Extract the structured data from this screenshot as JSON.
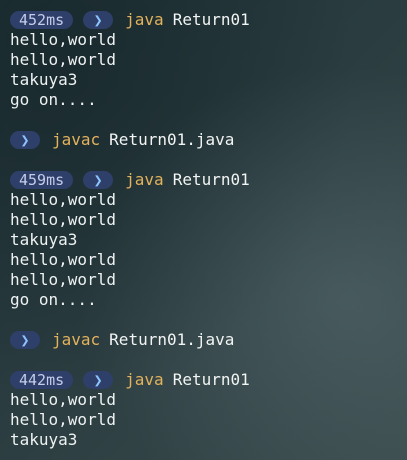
{
  "blocks": [
    {
      "time": "452ms",
      "prompt_icon": "chevron-right-icon",
      "command": "java",
      "argument": "Return01",
      "output": [
        "hello,world",
        "hello,world",
        "takuya3",
        "go on...."
      ]
    },
    {
      "prompt_icon": "chevron-right-icon",
      "command": "javac",
      "argument": "Return01.java"
    },
    {
      "time": "459ms",
      "prompt_icon": "chevron-right-icon",
      "command": "java",
      "argument": "Return01",
      "output": [
        "hello,world",
        "hello,world",
        "takuya3",
        "hello,world",
        "hello,world",
        "go on...."
      ]
    },
    {
      "prompt_icon": "chevron-right-icon",
      "command": "javac",
      "argument": "Return01.java"
    },
    {
      "time": "442ms",
      "prompt_icon": "chevron-right-icon",
      "command": "java",
      "argument": "Return01",
      "output": [
        "hello,world",
        "hello,world",
        "takuya3"
      ]
    }
  ],
  "colors": {
    "background": "#26373b",
    "badge": "#2e3f6a",
    "command": "#e3b25c",
    "chevron": "#8ec3ff",
    "text": "#eef2f3"
  }
}
